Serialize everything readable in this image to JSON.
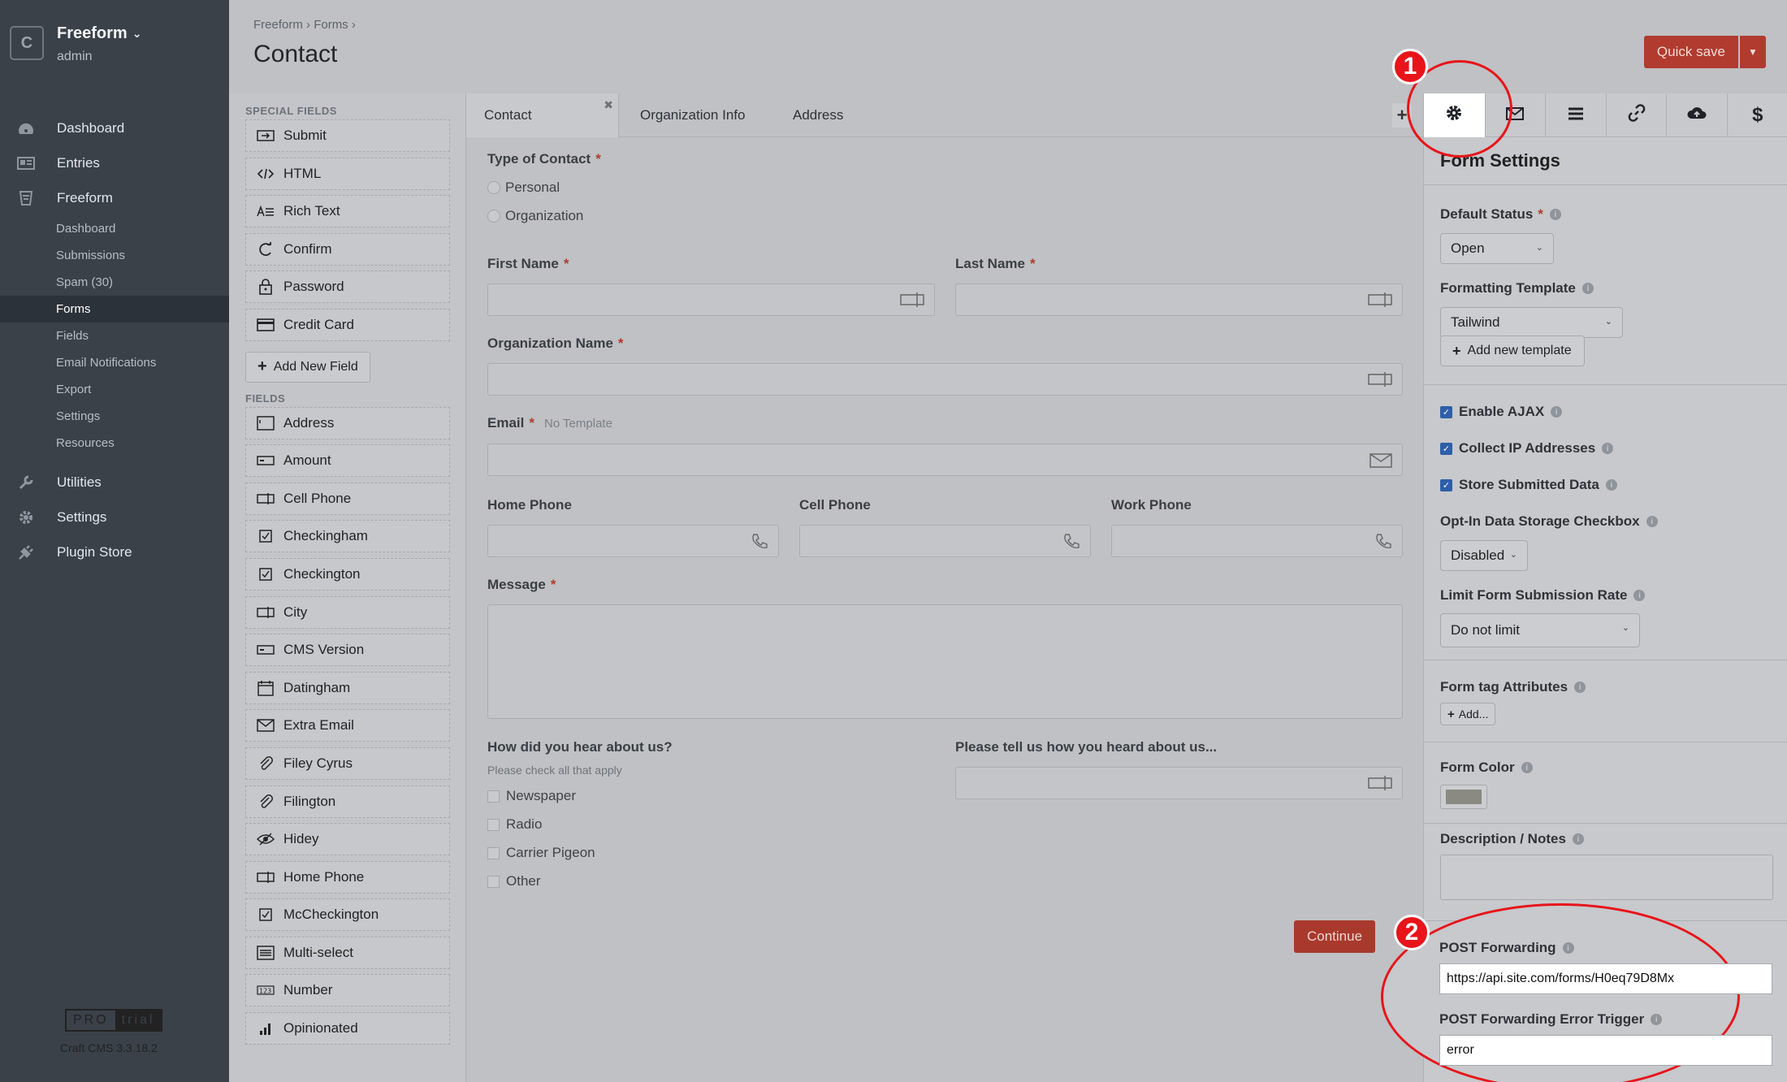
{
  "sidebar": {
    "brand": "Freeform",
    "user": "admin",
    "logo_letter": "C",
    "nav": [
      {
        "label": "Dashboard",
        "icon": "dashboard-icon"
      },
      {
        "label": "Entries",
        "icon": "entries-icon"
      },
      {
        "label": "Freeform",
        "icon": "freeform-icon"
      }
    ],
    "sub": [
      "Dashboard",
      "Submissions",
      "Spam (30)",
      "Forms",
      "Fields",
      "Email Notifications",
      "Export",
      "Settings",
      "Resources"
    ],
    "nav2": [
      {
        "label": "Utilities",
        "icon": "wrench-icon"
      },
      {
        "label": "Settings",
        "icon": "gear-icon"
      },
      {
        "label": "Plugin Store",
        "icon": "plug-icon"
      }
    ],
    "pro": "PRO",
    "trial": "trial",
    "craft_version": "Craft CMS 3.3.18.2"
  },
  "header": {
    "breadcrumb": [
      "Freeform",
      "Forms"
    ],
    "title": "Contact",
    "quick_save": "Quick save"
  },
  "library": {
    "special_heading": "SPECIAL FIELDS",
    "special": [
      "Submit",
      "HTML",
      "Rich Text",
      "Confirm",
      "Password",
      "Credit Card"
    ],
    "add_new": "Add New Field",
    "fields_heading": "FIELDS",
    "fields": [
      "Address",
      "Amount",
      "Cell Phone",
      "Checkingham",
      "Checkington",
      "City",
      "CMS Version",
      "Datingham",
      "Extra Email",
      "Filey Cyrus",
      "Filington",
      "Hidey",
      "Home Phone",
      "McCheckington",
      "Multi-select",
      "Number",
      "Opinionated"
    ]
  },
  "canvas": {
    "tabs": [
      "Contact",
      "Organization Info",
      "Address"
    ],
    "type_of_contact": "Type of Contact",
    "type_options": [
      "Personal",
      "Organization"
    ],
    "first_name": "First Name",
    "last_name": "Last Name",
    "org_name": "Organization Name",
    "email": "Email",
    "email_hint": "No Template",
    "home_phone": "Home Phone",
    "cell_phone": "Cell Phone",
    "work_phone": "Work Phone",
    "message": "Message",
    "hear_about": "How did you hear about us?",
    "hear_hint": "Please check all that apply",
    "hear_options": [
      "Newspaper",
      "Radio",
      "Carrier Pigeon",
      "Other"
    ],
    "tell_us": "Please tell us how you heard about us...",
    "continue": "Continue"
  },
  "settings": {
    "title": "Form Settings",
    "default_status_label": "Default Status",
    "default_status": "Open",
    "template_label": "Formatting Template",
    "template": "Tailwind",
    "add_template": "Add new template",
    "enable_ajax": "Enable AJAX",
    "collect_ip": "Collect IP Addresses",
    "store_data": "Store Submitted Data",
    "optin_label": "Opt-In Data Storage Checkbox",
    "optin": "Disabled",
    "limit_label": "Limit Form Submission Rate",
    "limit": "Do not limit",
    "tag_attr_label": "Form tag Attributes",
    "tag_attr_add": "Add...",
    "color_label": "Form Color",
    "color_value": "#8a8a82",
    "notes_label": "Description / Notes",
    "post_fwd_label": "POST Forwarding",
    "post_fwd": "https://api.site.com/forms/H0eq79D8Mx",
    "post_err_label": "POST Forwarding Error Trigger",
    "post_err": "error"
  },
  "annotations": {
    "badge1": "1",
    "badge2": "2",
    "color": "#e8141a"
  }
}
